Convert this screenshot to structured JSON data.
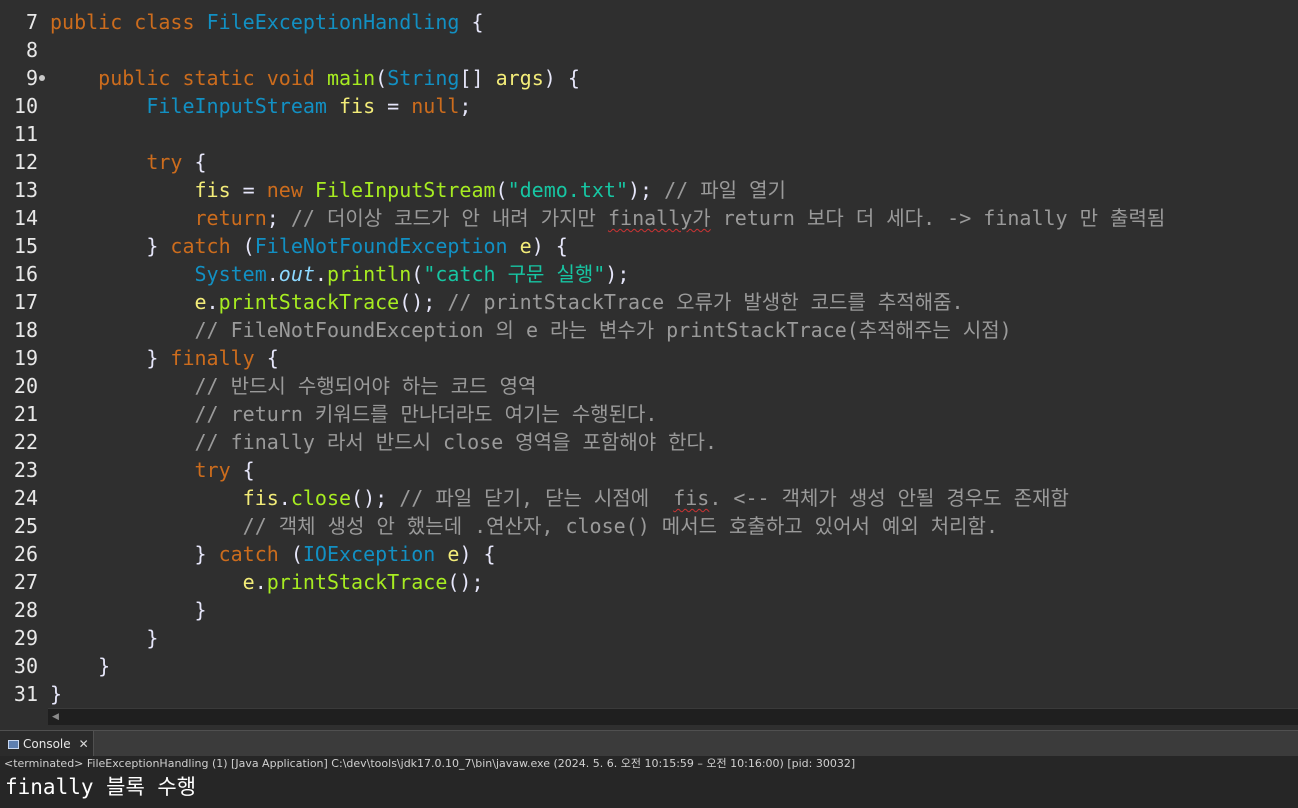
{
  "editor": {
    "lines": [
      {
        "num": "7",
        "tokens": [
          {
            "c": "kw",
            "t": "public"
          },
          {
            "c": "pl",
            "t": " "
          },
          {
            "c": "kw",
            "t": "class"
          },
          {
            "c": "pl",
            "t": " "
          },
          {
            "c": "ty",
            "t": "FileExceptionHandling"
          },
          {
            "c": "pl",
            "t": " {"
          }
        ]
      },
      {
        "num": "8",
        "tokens": []
      },
      {
        "num": "9",
        "marker": true,
        "tokens": [
          {
            "c": "pl",
            "t": "    "
          },
          {
            "c": "kw",
            "t": "public"
          },
          {
            "c": "pl",
            "t": " "
          },
          {
            "c": "kw",
            "t": "static"
          },
          {
            "c": "pl",
            "t": " "
          },
          {
            "c": "kw",
            "t": "void"
          },
          {
            "c": "pl",
            "t": " "
          },
          {
            "c": "fn",
            "t": "main"
          },
          {
            "c": "pl",
            "t": "("
          },
          {
            "c": "ty",
            "t": "String"
          },
          {
            "c": "pl",
            "t": "[] "
          },
          {
            "c": "var",
            "t": "args"
          },
          {
            "c": "pl",
            "t": ") {"
          }
        ]
      },
      {
        "num": "10",
        "tokens": [
          {
            "c": "pl",
            "t": "        "
          },
          {
            "c": "ty",
            "t": "FileInputStream"
          },
          {
            "c": "pl",
            "t": " "
          },
          {
            "c": "var",
            "t": "fis"
          },
          {
            "c": "pl",
            "t": " = "
          },
          {
            "c": "kw",
            "t": "null"
          },
          {
            "c": "pl",
            "t": ";"
          }
        ]
      },
      {
        "num": "11",
        "tokens": []
      },
      {
        "num": "12",
        "tokens": [
          {
            "c": "pl",
            "t": "        "
          },
          {
            "c": "kw",
            "t": "try"
          },
          {
            "c": "pl",
            "t": " {"
          }
        ]
      },
      {
        "num": "13",
        "tokens": [
          {
            "c": "pl",
            "t": "            "
          },
          {
            "c": "var",
            "t": "fis"
          },
          {
            "c": "pl",
            "t": " = "
          },
          {
            "c": "kw",
            "t": "new"
          },
          {
            "c": "pl",
            "t": " "
          },
          {
            "c": "fn",
            "t": "FileInputStream"
          },
          {
            "c": "pl",
            "t": "("
          },
          {
            "c": "st",
            "t": "\"demo.txt\""
          },
          {
            "c": "pl",
            "t": "); "
          },
          {
            "c": "cm",
            "t": "// 파일 열기"
          }
        ]
      },
      {
        "num": "14",
        "tokens": [
          {
            "c": "pl",
            "t": "            "
          },
          {
            "c": "kw",
            "t": "return"
          },
          {
            "c": "pl",
            "t": "; "
          },
          {
            "c": "cm",
            "t": "// 더이상 코드가 안 내려 가지만 "
          },
          {
            "c": "cm sq",
            "t": "finally가"
          },
          {
            "c": "cm",
            "t": " return 보다 더 세다. -> finally 만 출력됨"
          }
        ]
      },
      {
        "num": "15",
        "tokens": [
          {
            "c": "pl",
            "t": "        } "
          },
          {
            "c": "kw",
            "t": "catch"
          },
          {
            "c": "pl",
            "t": " ("
          },
          {
            "c": "ty",
            "t": "FileNotFoundException"
          },
          {
            "c": "pl",
            "t": " "
          },
          {
            "c": "var",
            "t": "e"
          },
          {
            "c": "pl",
            "t": ") {"
          }
        ]
      },
      {
        "num": "16",
        "tokens": [
          {
            "c": "pl",
            "t": "            "
          },
          {
            "c": "ty",
            "t": "System"
          },
          {
            "c": "pl",
            "t": "."
          },
          {
            "c": "fld",
            "t": "out"
          },
          {
            "c": "pl",
            "t": "."
          },
          {
            "c": "fn",
            "t": "println"
          },
          {
            "c": "pl",
            "t": "("
          },
          {
            "c": "st",
            "t": "\"catch 구문 실행\""
          },
          {
            "c": "pl",
            "t": ");"
          }
        ]
      },
      {
        "num": "17",
        "tokens": [
          {
            "c": "pl",
            "t": "            "
          },
          {
            "c": "var",
            "t": "e"
          },
          {
            "c": "pl",
            "t": "."
          },
          {
            "c": "fn",
            "t": "printStackTrace"
          },
          {
            "c": "pl",
            "t": "(); "
          },
          {
            "c": "cm",
            "t": "// printStackTrace 오류가 발생한 코드를 추적해줌."
          }
        ]
      },
      {
        "num": "18",
        "tokens": [
          {
            "c": "pl",
            "t": "            "
          },
          {
            "c": "cm",
            "t": "// FileNotFoundException 의 e 라는 변수가 printStackTrace(추적해주는 시점)"
          }
        ]
      },
      {
        "num": "19",
        "tokens": [
          {
            "c": "pl",
            "t": "        } "
          },
          {
            "c": "kw",
            "t": "finally"
          },
          {
            "c": "pl",
            "t": " {"
          }
        ]
      },
      {
        "num": "20",
        "tokens": [
          {
            "c": "pl",
            "t": "            "
          },
          {
            "c": "cm",
            "t": "// 반드시 수행되어야 하는 코드 영역"
          }
        ]
      },
      {
        "num": "21",
        "tokens": [
          {
            "c": "pl",
            "t": "            "
          },
          {
            "c": "cm",
            "t": "// return 키워드를 만나더라도 여기는 수행된다."
          }
        ]
      },
      {
        "num": "22",
        "tokens": [
          {
            "c": "pl",
            "t": "            "
          },
          {
            "c": "cm",
            "t": "// finally 라서 반드시 close 영역을 포함해야 한다."
          }
        ]
      },
      {
        "num": "23",
        "tokens": [
          {
            "c": "pl",
            "t": "            "
          },
          {
            "c": "kw",
            "t": "try"
          },
          {
            "c": "pl",
            "t": " {"
          }
        ]
      },
      {
        "num": "24",
        "tokens": [
          {
            "c": "pl",
            "t": "                "
          },
          {
            "c": "var",
            "t": "fis"
          },
          {
            "c": "pl",
            "t": "."
          },
          {
            "c": "fn",
            "t": "close"
          },
          {
            "c": "pl",
            "t": "(); "
          },
          {
            "c": "cm",
            "t": "// 파일 닫기, 닫는 시점에  "
          },
          {
            "c": "cm sq",
            "t": "fis"
          },
          {
            "c": "cm",
            "t": ". <-- 객체가 생성 안될 경우도 존재함"
          }
        ]
      },
      {
        "num": "25",
        "tokens": [
          {
            "c": "pl",
            "t": "                "
          },
          {
            "c": "cm",
            "t": "// 객체 생성 안 했는데 .연산자, close() 메서드 호출하고 있어서 예외 처리함."
          }
        ]
      },
      {
        "num": "26",
        "tokens": [
          {
            "c": "pl",
            "t": "            } "
          },
          {
            "c": "kw",
            "t": "catch"
          },
          {
            "c": "pl",
            "t": " ("
          },
          {
            "c": "ty",
            "t": "IOException"
          },
          {
            "c": "pl",
            "t": " "
          },
          {
            "c": "var",
            "t": "e"
          },
          {
            "c": "pl",
            "t": ") {"
          }
        ]
      },
      {
        "num": "27",
        "tokens": [
          {
            "c": "pl",
            "t": "                "
          },
          {
            "c": "var",
            "t": "e"
          },
          {
            "c": "pl",
            "t": "."
          },
          {
            "c": "fn",
            "t": "printStackTrace"
          },
          {
            "c": "pl",
            "t": "();"
          }
        ]
      },
      {
        "num": "28",
        "tokens": [
          {
            "c": "pl",
            "t": "            }"
          }
        ]
      },
      {
        "num": "29",
        "tokens": [
          {
            "c": "pl",
            "t": "        }"
          }
        ]
      },
      {
        "num": "30",
        "tokens": [
          {
            "c": "pl",
            "t": "    }"
          }
        ]
      },
      {
        "num": "31",
        "tokens": [
          {
            "c": "pl",
            "t": "}"
          }
        ]
      }
    ]
  },
  "console": {
    "tab_label": "Console",
    "status": "<terminated> FileExceptionHandling (1) [Java Application] C:\\dev\\tools\\jdk17.0.10_7\\bin\\javaw.exe  (2024. 5. 6. 오전 10:15:59 – 오전 10:16:00) [pid: 30032]",
    "output": "finally 블록 수행"
  },
  "colors": {
    "keyword": "#cc6c1d",
    "type": "#1290c3",
    "method": "#a7ec21",
    "variable": "#f3ec79",
    "string": "#17c6a3",
    "comment": "#9a9a9a",
    "field": "#8dd9ff",
    "background": "#2f2f2f"
  }
}
